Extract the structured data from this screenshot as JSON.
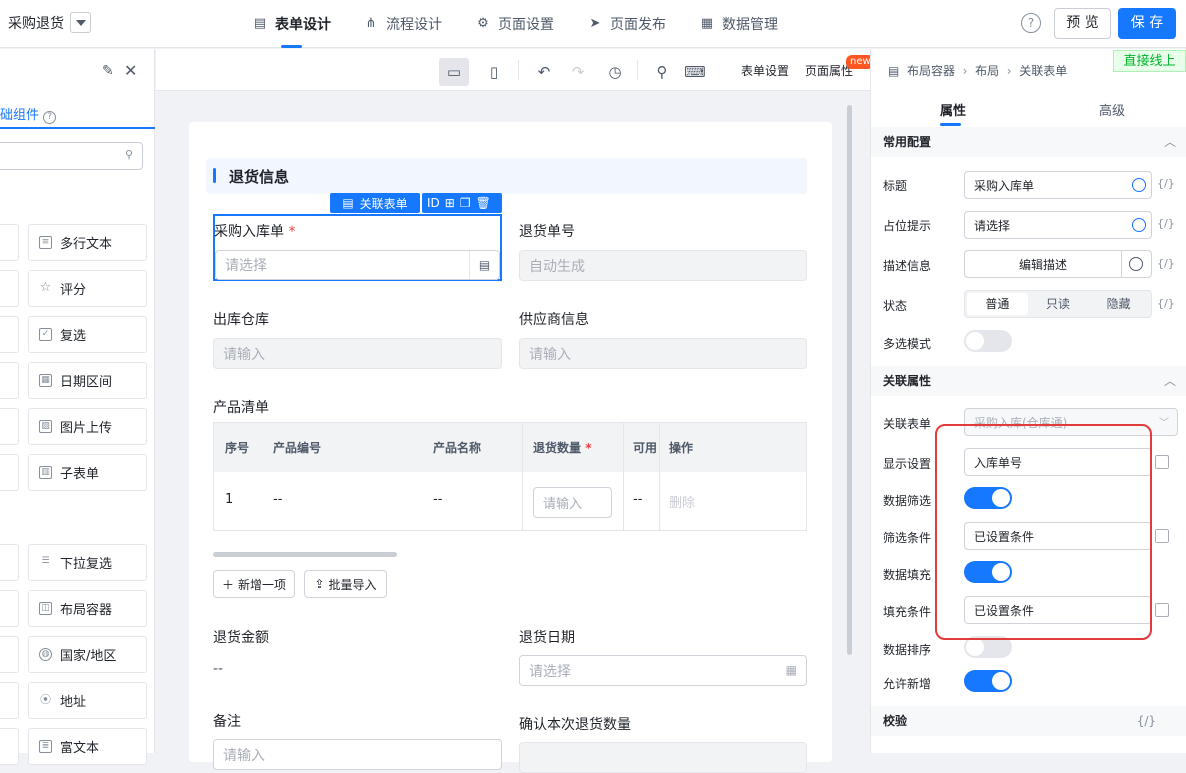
{
  "topbar": {
    "app_title": "采购退货",
    "tabs": [
      {
        "label": "表单设计",
        "icon": "form-icon"
      },
      {
        "label": "流程设计",
        "icon": "flow-icon"
      },
      {
        "label": "页面设置",
        "icon": "gear-icon"
      },
      {
        "label": "页面发布",
        "icon": "send-icon"
      },
      {
        "label": "数据管理",
        "icon": "grid-icon"
      }
    ],
    "help": "?",
    "preview": "预 览",
    "save": "保 存",
    "go_live": "直接线上"
  },
  "left": {
    "tab_label": "础组件",
    "components_right": [
      "多行文本",
      "评分",
      "复选",
      "日期区间",
      "图片上传",
      "子表单",
      "下拉复选",
      "布局容器",
      "国家/地区",
      "地址",
      "富文本"
    ]
  },
  "toolbar": {
    "form_settings": "表单设置",
    "page_props": "页面属性",
    "new_badge": "new",
    "breadcrumb": [
      "布局容器",
      "布局",
      "关联表单"
    ]
  },
  "form": {
    "section_title": "退货信息",
    "selected_tag": "关联表单",
    "tools_id": "ID",
    "fields": {
      "purchase_label": "采购入库单",
      "purchase_placeholder": "请选择",
      "return_no_label": "退货单号",
      "return_no_value": "自动生成",
      "warehouse_label": "出库仓库",
      "warehouse_placeholder": "请输入",
      "supplier_label": "供应商信息",
      "supplier_placeholder": "请输入",
      "product_list_label": "产品清单",
      "amount_label": "退货金额",
      "amount_value": "--",
      "date_label": "退货日期",
      "date_placeholder": "请选择",
      "remark_label": "备注",
      "remark_placeholder": "请输入",
      "confirm_label": "确认本次退货数量"
    },
    "table": {
      "headers": [
        "序号",
        "产品编号",
        "产品名称",
        "退货数量",
        "可用",
        "操作"
      ],
      "row": {
        "index": "1",
        "code": "--",
        "name": "--",
        "qty_placeholder": "请输入",
        "avail": "--",
        "action": "删除"
      }
    },
    "add_row": "新增一项",
    "batch_import": "批量导入"
  },
  "right": {
    "tabs": [
      "属性",
      "高级"
    ],
    "group_common": "常用配置",
    "title_label": "标题",
    "title_value": "采购入库单",
    "placeholder_label": "占位提示",
    "placeholder_value": "请选择",
    "desc_label": "描述信息",
    "desc_btn": "编辑描述",
    "state_label": "状态",
    "state_options": [
      "普通",
      "只读",
      "隐藏"
    ],
    "multi_label": "多选模式",
    "group_link": "关联属性",
    "link_form_label": "关联表单",
    "link_form_value": "采购入库(仓库通)",
    "display_label": "显示设置",
    "display_value": "入库单号",
    "filter_label": "数据筛选",
    "filter_cond_label": "筛选条件",
    "filter_cond_value": "已设置条件",
    "fill_label": "数据填充",
    "fill_cond_label": "填充条件",
    "fill_cond_value": "已设置条件",
    "sort_label": "数据排序",
    "allow_add_label": "允许新增",
    "group_validate": "校验",
    "fx": "{/}"
  }
}
